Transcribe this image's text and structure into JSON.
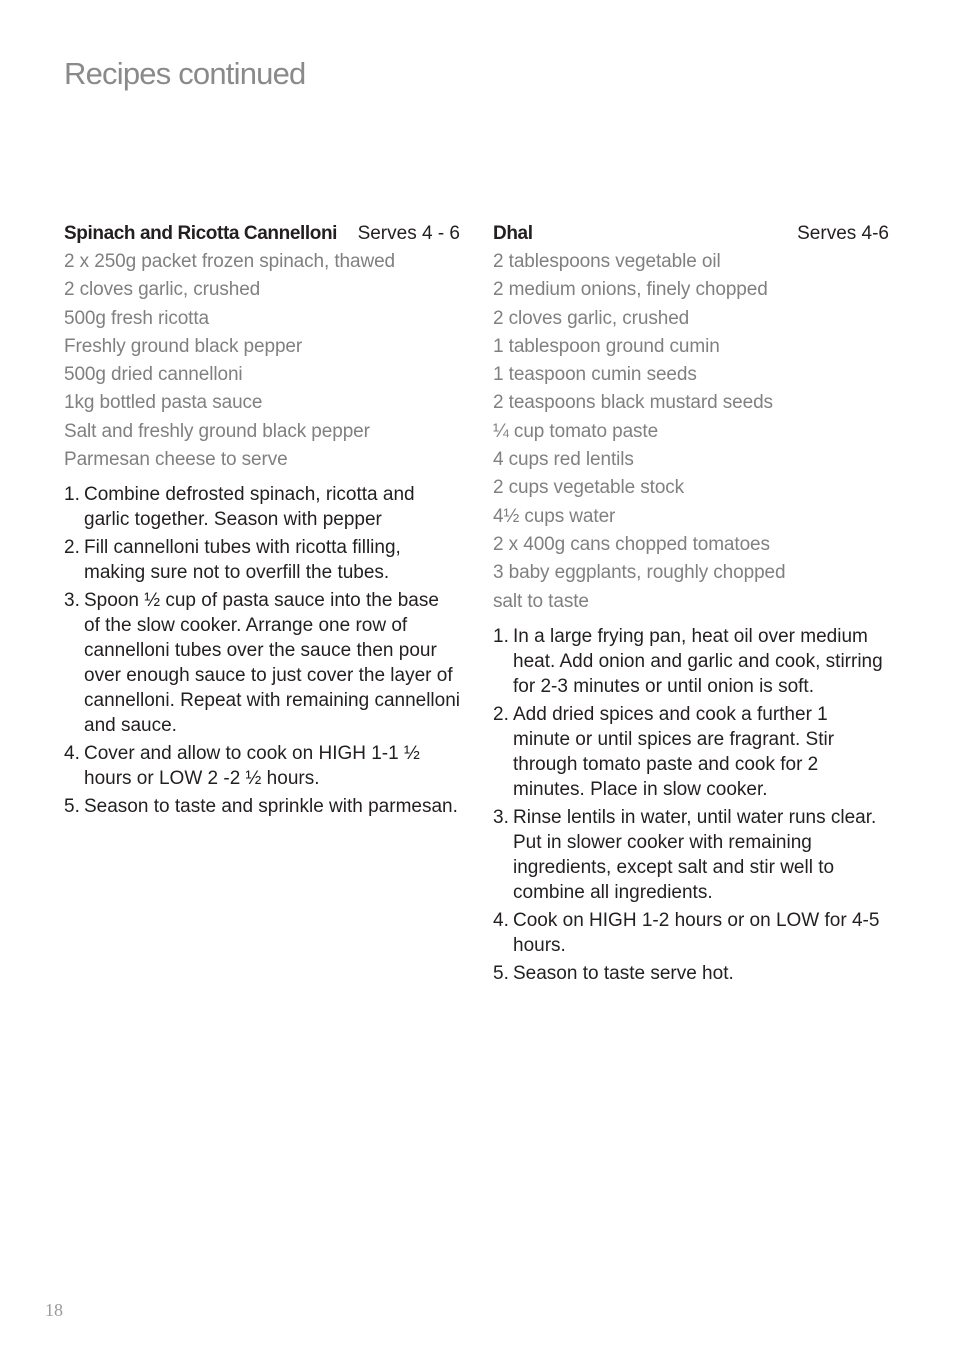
{
  "page": {
    "title": "Recipes continued",
    "page_number": "18"
  },
  "recipes": [
    {
      "name": "Spinach and Ricotta Cannelloni",
      "serves": "Serves 4 - 6",
      "ingredients": [
        "2 x 250g packet frozen spinach, thawed",
        "2 cloves garlic, crushed",
        "500g fresh ricotta",
        "Freshly ground black pepper",
        "500g dried cannelloni",
        "1kg bottled pasta sauce",
        "Salt and freshly ground black pepper",
        "Parmesan cheese to serve"
      ],
      "steps": [
        {
          "num": "1.",
          "text": "Combine defrosted spinach, ricotta and garlic together. Season with pepper"
        },
        {
          "num": "2.",
          "text": "Fill cannelloni tubes with ricotta filling, making sure not to overfill the tubes."
        },
        {
          "num": "3.",
          "text": "Spoon ½ cup of pasta sauce into the base of the slow cooker. Arrange one row of cannelloni tubes over the sauce then pour over enough sauce to just cover the layer of cannelloni.  Repeat with remaining cannelloni and sauce."
        },
        {
          "num": "4.",
          "text": "Cover and allow to cook on HIGH 1-1 ½ hours or LOW 2 -2 ½ hours."
        },
        {
          "num": "5.",
          "text": "Season to taste and sprinkle with parmesan."
        }
      ]
    },
    {
      "name": "Dhal",
      "serves": "Serves 4-6",
      "ingredients": [
        "2 tablespoons vegetable oil",
        "2 medium onions, finely chopped",
        "2 cloves garlic, crushed",
        "1 tablespoon ground cumin",
        "1 teaspoon cumin seeds",
        "2 teaspoons black mustard seeds",
        "¼ cup tomato paste",
        "4 cups red lentils",
        "2 cups vegetable stock",
        "4½ cups water",
        "2 x 400g cans chopped tomatoes",
        "3 baby eggplants, roughly chopped",
        "salt to taste"
      ],
      "steps": [
        {
          "num": "1.",
          "text": "In a large frying pan, heat oil over medium heat. Add onion and garlic and cook, stirring for 2-3 minutes or until onion is soft."
        },
        {
          "num": "2.",
          "text": "Add dried spices and cook a further 1 minute or until spices are fragrant. Stir through tomato paste and cook for 2 minutes. Place in slow cooker."
        },
        {
          "num": "3.",
          "text": "Rinse lentils in water, until water runs clear. Put in slower cooker with remaining ingredients, except salt and stir well to combine all ingredients."
        },
        {
          "num": "4.",
          "text": "Cook on HIGH 1-2 hours or on LOW for 4-5 hours."
        },
        {
          "num": "5.",
          "text": "Season to taste serve hot."
        }
      ]
    }
  ]
}
